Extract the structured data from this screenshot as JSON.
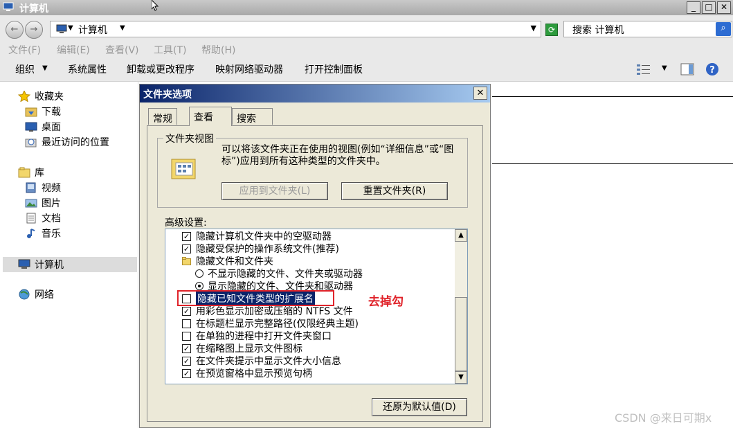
{
  "window": {
    "title": "计算机"
  },
  "address": {
    "path": "计算机",
    "search_placeholder": "搜索 计算机"
  },
  "menu": [
    "文件(F)",
    "编辑(E)",
    "查看(V)",
    "工具(T)",
    "帮助(H)"
  ],
  "toolbar": {
    "organize": "组织",
    "items": [
      "系统属性",
      "卸载或更改程序",
      "映射网络驱动器",
      "打开控制面板"
    ]
  },
  "sidebar": {
    "favorites": {
      "label": "收藏夹",
      "items": [
        "下载",
        "桌面",
        "最近访问的位置"
      ]
    },
    "library": {
      "label": "库",
      "items": [
        "视频",
        "图片",
        "文档",
        "音乐"
      ]
    },
    "computer": "计算机",
    "network": "网络"
  },
  "dialog": {
    "title": "文件夹选项",
    "tabs": [
      "常规",
      "查看",
      "搜索"
    ],
    "active_tab": "查看",
    "folder_view": {
      "label": "文件夹视图",
      "description": "可以将该文件夹正在使用的视图(例如“详细信息”或“图标”)应用到所有这种类型的文件夹中。",
      "apply_button": "应用到文件夹(L)",
      "reset_button": "重置文件夹(R)"
    },
    "advanced_label": "高级设置:",
    "settings": [
      {
        "type": "checkbox",
        "checked": true,
        "label": "隐藏计算机文件夹中的空驱动器"
      },
      {
        "type": "checkbox",
        "checked": true,
        "label": "隐藏受保护的操作系统文件(推荐)"
      },
      {
        "type": "folder",
        "label": "隐藏文件和文件夹"
      },
      {
        "type": "radio",
        "checked": false,
        "label": "不显示隐藏的文件、文件夹或驱动器"
      },
      {
        "type": "radio",
        "checked": true,
        "label": "显示隐藏的文件、文件夹和驱动器"
      },
      {
        "type": "checkbox",
        "checked": false,
        "selected": true,
        "label": "隐藏已知文件类型的扩展名"
      },
      {
        "type": "checkbox",
        "checked": true,
        "label": "用彩色显示加密或压缩的 NTFS 文件"
      },
      {
        "type": "checkbox",
        "checked": false,
        "label": "在标题栏显示完整路径(仅限经典主题)"
      },
      {
        "type": "checkbox",
        "checked": false,
        "label": "在单独的进程中打开文件夹窗口"
      },
      {
        "type": "checkbox",
        "checked": true,
        "label": "在缩略图上显示文件图标"
      },
      {
        "type": "checkbox",
        "checked": true,
        "label": "在文件夹提示中显示文件大小信息"
      },
      {
        "type": "checkbox",
        "checked": true,
        "label": "在预览窗格中显示预览句柄"
      }
    ],
    "restore_button": "还原为默认值(D)"
  },
  "annotation": "去掉勾",
  "watermark": "CSDN @来日可期x",
  "colors": {
    "annotation": "#e0232a",
    "dialog_title": "#0a246a",
    "highlight": "#0a246a"
  }
}
